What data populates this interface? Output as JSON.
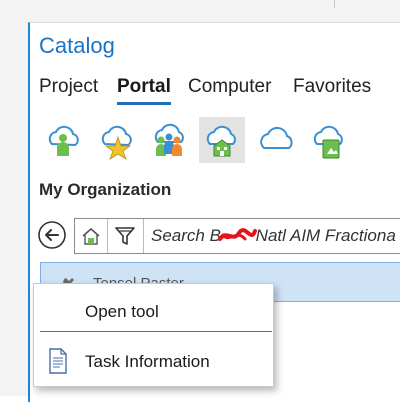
{
  "pane": {
    "title": "Catalog",
    "tabs": [
      {
        "label": "Project",
        "active": false
      },
      {
        "label": "Portal",
        "active": true
      },
      {
        "label": "Computer",
        "active": false
      },
      {
        "label": "Favorites",
        "active": false
      }
    ],
    "sources": [
      {
        "icon": "my-content-cloud-icon",
        "selected": false
      },
      {
        "icon": "favorites-cloud-icon",
        "selected": false
      },
      {
        "icon": "groups-cloud-icon",
        "selected": false
      },
      {
        "icon": "my-organization-cloud-icon",
        "selected": true
      },
      {
        "icon": "arcgis-online-cloud-icon",
        "selected": false
      },
      {
        "icon": "living-atlas-cloud-icon",
        "selected": false
      }
    ],
    "section_label": "My Organization",
    "search": {
      "value": "Search BLM Natl AIM Fractiona",
      "prefix": "Search B",
      "suffix": " Natl AIM Fractiona"
    },
    "result": {
      "text": "Tensel Paster"
    }
  },
  "context_menu": {
    "items": [
      {
        "label": "Open tool",
        "icon": ""
      },
      {
        "label": "Task Information",
        "icon": "document-icon"
      }
    ]
  },
  "colors": {
    "accent": "#1b74c5",
    "selection": "#cfe3f6",
    "tab_underline": "#1f6fb7"
  }
}
